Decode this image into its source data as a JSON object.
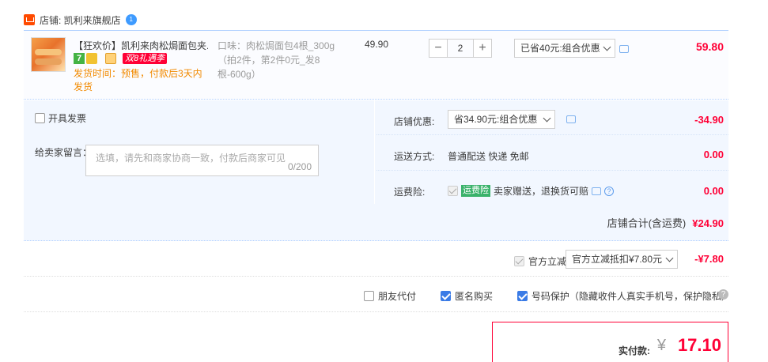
{
  "shop": {
    "label": "店铺: 凯利来旗舰店",
    "badge": "1"
  },
  "item": {
    "title": "【狂欢价】凯利来肉松焗面包夹...",
    "tag_seven": "7",
    "promo_tag": "双8礼遇季",
    "ship_time": "发货时间：预售，付款后3天内发货",
    "spec": "口味：肉松焗面包4根_300g（拍2件，第2件0元_发8根-600g）",
    "unit_price": "49.90",
    "qty_minus": "−",
    "qty_value": "2",
    "qty_plus": "+",
    "promo_select": "已省40元:组合优惠",
    "total": "59.80"
  },
  "invoice": {
    "label": "开具发票"
  },
  "message": {
    "label": "给卖家留言：",
    "placeholder": "选填，请先和商家协商一致，付款后商家可见",
    "count": "0/200"
  },
  "discount": {
    "label": "店铺优惠:",
    "select": "省34.90元:组合优惠",
    "value": "-34.90"
  },
  "shipping": {
    "label": "运送方式:",
    "method": "普通配送 快递 免邮",
    "value": "0.00"
  },
  "insurance": {
    "label": "运费险:",
    "tag": "运费险",
    "text": "卖家赠送，退换货可赔",
    "value": "0.00"
  },
  "shop_total": {
    "label": "店铺合计(含运费)",
    "amount": "¥24.90"
  },
  "official": {
    "label": "官方立减",
    "select": "官方立减抵扣¥7.80元",
    "value": "-¥7.80"
  },
  "options": {
    "friend_pay": "朋友代付",
    "anonymous": "匿名购买",
    "number_protect": "号码保护（隐藏收件人真实手机号，保护隐私）",
    "help": "?"
  },
  "payment": {
    "label": "实付款:",
    "currency": "¥",
    "amount": "17.10"
  }
}
